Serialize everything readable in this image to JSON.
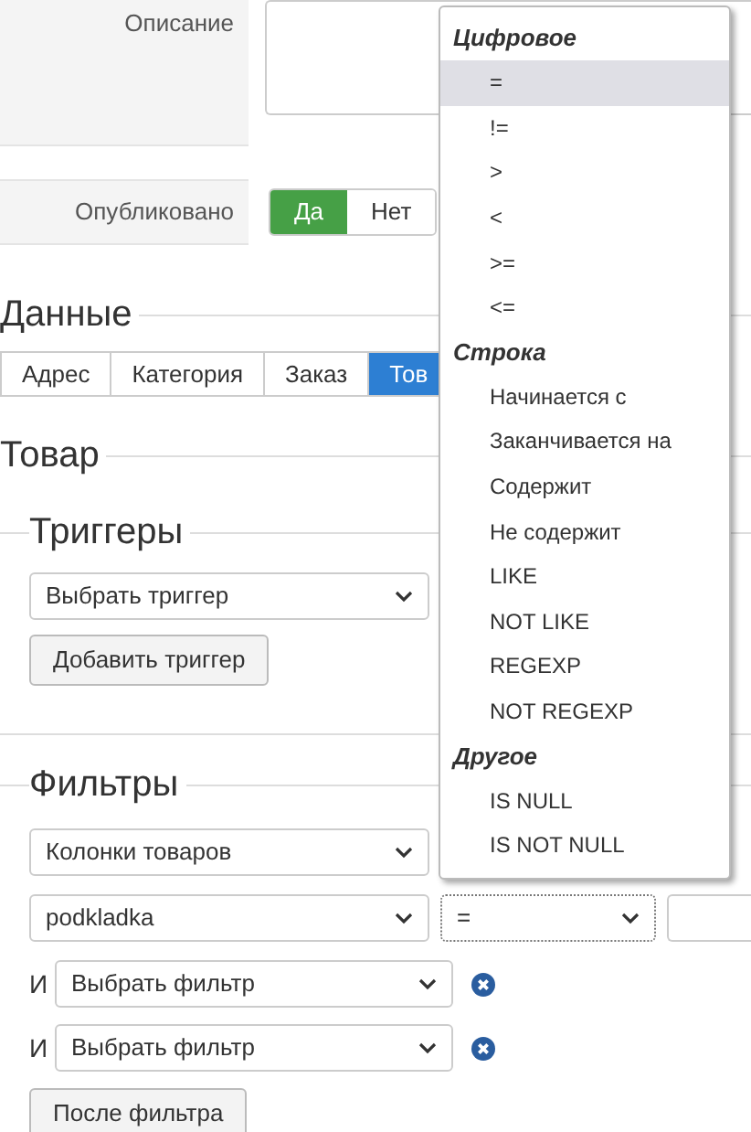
{
  "description": {
    "label": "Описание"
  },
  "published": {
    "label": "Опубликовано",
    "options": [
      {
        "label": "Да",
        "selected": true
      },
      {
        "label": "Нет",
        "selected": false
      }
    ]
  },
  "data": {
    "title": "Данные",
    "tabs": [
      {
        "label": "Адрес",
        "selected": false
      },
      {
        "label": "Категория",
        "selected": false
      },
      {
        "label": "Заказ",
        "selected": false
      },
      {
        "label": "Тов",
        "selected": true
      }
    ]
  },
  "product": {
    "title": "Товар",
    "triggers": {
      "title": "Триггеры",
      "select": "Выбрать триггер",
      "button": "Добавить триггер"
    },
    "filters": {
      "title": "Фильтры",
      "column_select": "Колонки товаров",
      "field_select": "podkladka",
      "operator_select": "=",
      "extra": [
        {
          "conjunction": "И",
          "select": "Выбрать фильтр"
        },
        {
          "conjunction": "И",
          "select": "Выбрать фильтр"
        }
      ],
      "button": "После фильтра"
    }
  },
  "operator_menu": [
    {
      "group": "Цифровое",
      "options": [
        {
          "label": "=",
          "selected": true
        },
        {
          "label": "!=",
          "selected": false
        },
        {
          "label": ">",
          "selected": false
        },
        {
          "label": "<",
          "selected": false
        },
        {
          "label": ">=",
          "selected": false
        },
        {
          "label": "<=",
          "selected": false
        }
      ]
    },
    {
      "group": "Строка",
      "options": [
        {
          "label": "Начинается с",
          "selected": false
        },
        {
          "label": "Заканчивается на",
          "selected": false
        },
        {
          "label": "Содержит",
          "selected": false
        },
        {
          "label": "Не содержит",
          "selected": false
        },
        {
          "label": "LIKE",
          "selected": false
        },
        {
          "label": "NOT LIKE",
          "selected": false
        },
        {
          "label": "REGEXP",
          "selected": false
        },
        {
          "label": "NOT REGEXP",
          "selected": false
        }
      ]
    },
    {
      "group": "Другое",
      "options": [
        {
          "label": "IS NULL",
          "selected": false
        },
        {
          "label": "IS NOT NULL",
          "selected": false
        }
      ]
    }
  ]
}
